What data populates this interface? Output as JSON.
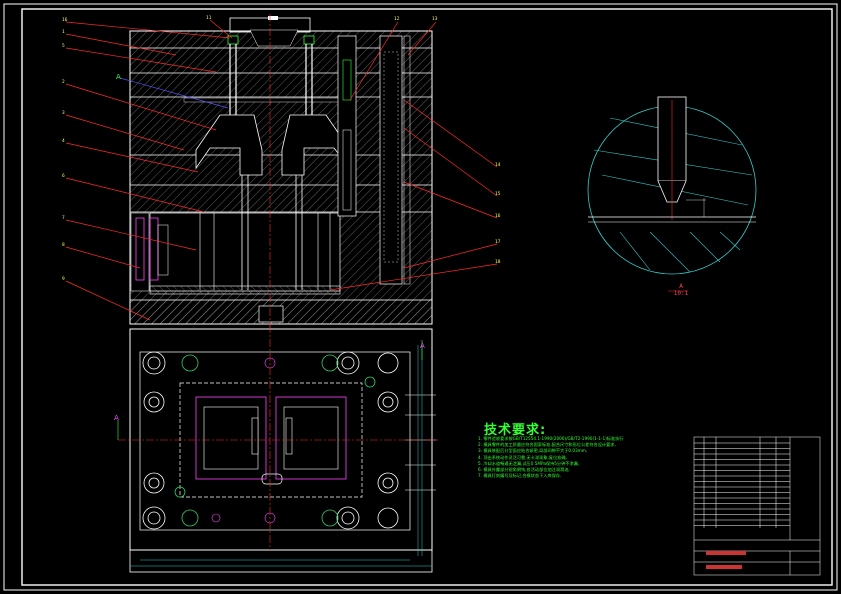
{
  "drawing": {
    "tech_requirements": {
      "title": "技术要求:",
      "notes": [
        "1. 零件验收要求按GB/T12554.1-1990(2006)/GB/T2-1990(1-1-1)标准执行",
        "2. 模具零件的加工质量应符合国家标准,配合尺寸和形位公差符合设计要求,",
        "3. 模具装配后分型面应贴合紧密,局部间隙不大于0.03mm,",
        "4. 顶出系统动作灵活可靠,无卡滞现象,复位准确,",
        "5. 冷却水道畅通无泄漏,试压0.5MPa保持5分钟不渗漏,",
        "6. 模具外露部分锐角倒钝,各活动部位加注润滑油,",
        "7. 模具打刻编号及标记,合模状态下入库保存."
      ]
    },
    "section_label": {
      "letter": "A",
      "scale": "10:1"
    },
    "view_marks": {
      "top_view": "A",
      "plan_left": "A",
      "plan_right": "A"
    },
    "balloons_left": [
      "16",
      "1",
      "5",
      "2",
      "3",
      "4",
      "6",
      "7",
      "8",
      "9"
    ],
    "balloons_top": [
      "11",
      "12",
      "13"
    ],
    "balloons_right": [
      "14",
      "15",
      "16",
      "17",
      "18"
    ]
  },
  "colors": {
    "background": "#000000",
    "frame": "#ffffff",
    "leader": "#ff2a2a",
    "text_green": "#33ff33",
    "hatch": "#d0d0d0",
    "cyan": "#33cccc",
    "magenta": "#ff44ff",
    "yellow": "#ffff55",
    "blue": "#5555ff"
  }
}
